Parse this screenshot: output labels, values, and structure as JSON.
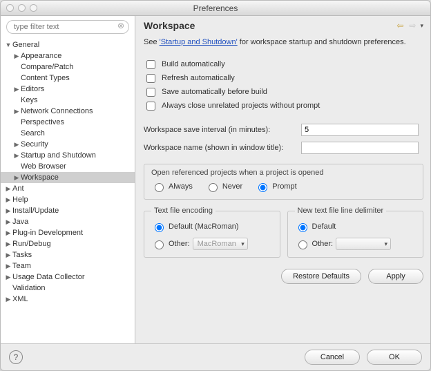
{
  "window": {
    "title": "Preferences"
  },
  "search": {
    "placeholder": "type filter text"
  },
  "tree": {
    "items": [
      {
        "label": "General",
        "expanded": true,
        "level": 0,
        "hasChildren": true
      },
      {
        "label": "Appearance",
        "level": 1,
        "hasChildren": true
      },
      {
        "label": "Compare/Patch",
        "level": 1,
        "hasChildren": false
      },
      {
        "label": "Content Types",
        "level": 1,
        "hasChildren": false
      },
      {
        "label": "Editors",
        "level": 1,
        "hasChildren": true
      },
      {
        "label": "Keys",
        "level": 1,
        "hasChildren": false
      },
      {
        "label": "Network Connections",
        "level": 1,
        "hasChildren": true
      },
      {
        "label": "Perspectives",
        "level": 1,
        "hasChildren": false
      },
      {
        "label": "Search",
        "level": 1,
        "hasChildren": false
      },
      {
        "label": "Security",
        "level": 1,
        "hasChildren": true
      },
      {
        "label": "Startup and Shutdown",
        "level": 1,
        "hasChildren": true
      },
      {
        "label": "Web Browser",
        "level": 1,
        "hasChildren": false
      },
      {
        "label": "Workspace",
        "level": 1,
        "hasChildren": true,
        "selected": true
      },
      {
        "label": "Ant",
        "level": 0,
        "hasChildren": true
      },
      {
        "label": "Help",
        "level": 0,
        "hasChildren": true
      },
      {
        "label": "Install/Update",
        "level": 0,
        "hasChildren": true
      },
      {
        "label": "Java",
        "level": 0,
        "hasChildren": true
      },
      {
        "label": "Plug-in Development",
        "level": 0,
        "hasChildren": true
      },
      {
        "label": "Run/Debug",
        "level": 0,
        "hasChildren": true
      },
      {
        "label": "Tasks",
        "level": 0,
        "hasChildren": true
      },
      {
        "label": "Team",
        "level": 0,
        "hasChildren": true
      },
      {
        "label": "Usage Data Collector",
        "level": 0,
        "hasChildren": true
      },
      {
        "label": "Validation",
        "level": 0,
        "hasChildren": false
      },
      {
        "label": "XML",
        "level": 0,
        "hasChildren": true
      }
    ]
  },
  "page": {
    "heading": "Workspace",
    "intro_prefix": "See ",
    "intro_link": "'Startup and Shutdown'",
    "intro_suffix": " for workspace startup and shutdown preferences.",
    "checks": {
      "build_auto": "Build automatically",
      "refresh_auto": "Refresh automatically",
      "save_before_build": "Save automatically before build",
      "close_unrelated": "Always close unrelated projects without prompt"
    },
    "interval_label": "Workspace save interval (in minutes):",
    "interval_value": "5",
    "name_label": "Workspace name (shown in window title):",
    "name_value": "",
    "open_ref": {
      "legend": "Open referenced projects when a project is opened",
      "always": "Always",
      "never": "Never",
      "prompt": "Prompt"
    },
    "encoding": {
      "legend": "Text file encoding",
      "default_label": "Default (MacRoman)",
      "other_label": "Other:",
      "other_value": "MacRoman"
    },
    "delimiter": {
      "legend": "New text file line delimiter",
      "default_label": "Default",
      "other_label": "Other:",
      "other_value": ""
    },
    "buttons": {
      "restore": "Restore Defaults",
      "apply": "Apply"
    }
  },
  "footer": {
    "cancel": "Cancel",
    "ok": "OK"
  }
}
